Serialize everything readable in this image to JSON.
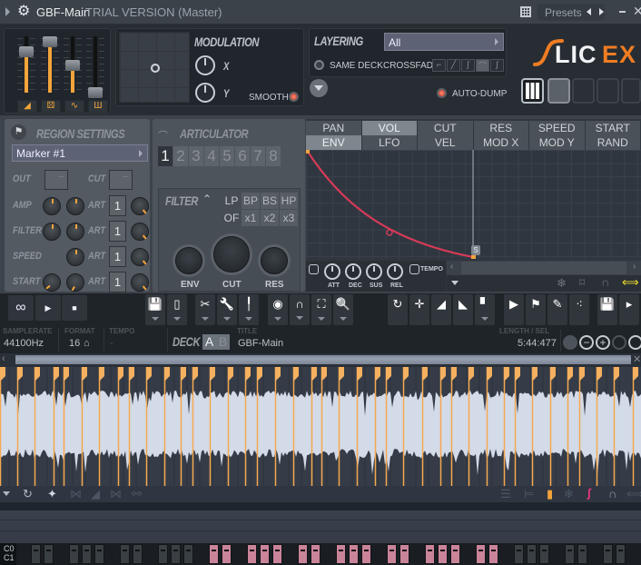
{
  "window": {
    "title": "GBF-Main",
    "subtitle": "TRIAL VERSION (Master)",
    "presets_label": "Presets",
    "close_glyph": "✕",
    "min_glyph": "—"
  },
  "top": {
    "sliders": [
      {
        "name": "master-volume",
        "level": 0.72
      },
      {
        "name": "master-pitch",
        "level": 0.95
      },
      {
        "name": "slider-3",
        "level": 0.48
      },
      {
        "name": "slider-4",
        "level": 0.0
      }
    ],
    "slider_buttons": [
      "◢",
      "⚄",
      "∿",
      "Ш"
    ],
    "modulation": {
      "title": "MODULATION",
      "x_label": "X",
      "y_label": "Y",
      "smooth_label": "SMOOTH"
    },
    "layering": {
      "title": "LAYERING",
      "dropdown_value": "All",
      "same_deck_label": "SAME DECK",
      "crossfade_label": "CROSSFADE",
      "crossfade_options": 5,
      "crossfade_selected": 4
    },
    "auto_dump_label": "AUTO-DUMP",
    "logo": {
      "part1": "LIC",
      "part2": "EX",
      "accent": "#f07c22"
    }
  },
  "region": {
    "title": "REGION SETTINGS",
    "marker_value": "Marker #1",
    "out_label": "OUT",
    "cut_label": "CUT",
    "rows": [
      {
        "label": "AMP",
        "art": "1"
      },
      {
        "label": "FILTER",
        "art": "1"
      },
      {
        "label": "SPEED",
        "art": "1"
      },
      {
        "label": "START",
        "art": "1"
      }
    ],
    "art_label": "ART",
    "dots": "..."
  },
  "articulator": {
    "title": "ARTICULATOR",
    "tabs": [
      "1",
      "2",
      "3",
      "4",
      "5",
      "6",
      "7",
      "8"
    ],
    "selected": 0,
    "filter": {
      "title": "FILTER",
      "types_row1": [
        "LP",
        "BP",
        "BS",
        "HP"
      ],
      "types_row2": [
        "OF",
        "x1",
        "x2",
        "x3"
      ],
      "knobs": [
        "ENV",
        "CUT",
        "RES"
      ]
    }
  },
  "envelope": {
    "tabs_row1": [
      "PAN",
      "VOL",
      "CUT",
      "RES",
      "SPEED",
      "START"
    ],
    "tabs_row2": [
      "ENV",
      "LFO",
      "VEL",
      "MOD X",
      "MOD Y",
      "RAND"
    ],
    "selected_row1": "VOL",
    "selected_row2": "ENV",
    "adsr": [
      "ATT",
      "DEC",
      "SUS",
      "REL"
    ],
    "tempo_label": "TEMPO",
    "sustain_marker": "S"
  },
  "toolbar": {
    "transport": [
      "∞",
      "▶",
      "■"
    ]
  },
  "info": {
    "samplerate_label": "SAMPLERATE",
    "samplerate_value": "44100Hz",
    "format_label": "FORMAT",
    "format_value": "16",
    "tempo_label": "TEMPO",
    "tempo_value": "-",
    "deck_label": "DECK",
    "deck_a": "A",
    "deck_b": "B",
    "title_label": "TITLE",
    "title_value": "GBF-Main",
    "length_label": "LENGTH / SEL",
    "length_value": "5:44:477"
  },
  "waveform": {
    "marker_count": 40
  },
  "keyboard": {
    "labels": [
      "C0",
      "C1"
    ],
    "pads": [
      {
        "active": false
      },
      {
        "active": false
      },
      {
        "active": false
      },
      {
        "active": false
      },
      {
        "active": false
      },
      {
        "active": false
      },
      {
        "active": false
      },
      {
        "active": false
      },
      {
        "active": false
      },
      {
        "active": false
      },
      {
        "active": true
      },
      {
        "active": true
      },
      {
        "active": true
      },
      {
        "active": true
      },
      {
        "active": true
      },
      {
        "active": true
      },
      {
        "active": true
      },
      {
        "active": true
      },
      {
        "active": true
      },
      {
        "active": true
      },
      {
        "active": true
      },
      {
        "active": true
      },
      {
        "active": true
      },
      {
        "active": true
      },
      {
        "active": true
      },
      {
        "active": true
      },
      {
        "active": true
      },
      {
        "active": false
      },
      {
        "active": false
      },
      {
        "active": false
      },
      {
        "active": false
      },
      {
        "active": false
      },
      {
        "active": false
      },
      {
        "active": false
      }
    ],
    "active_color": "#c98499",
    "inactive_color": "#3a3f44"
  }
}
